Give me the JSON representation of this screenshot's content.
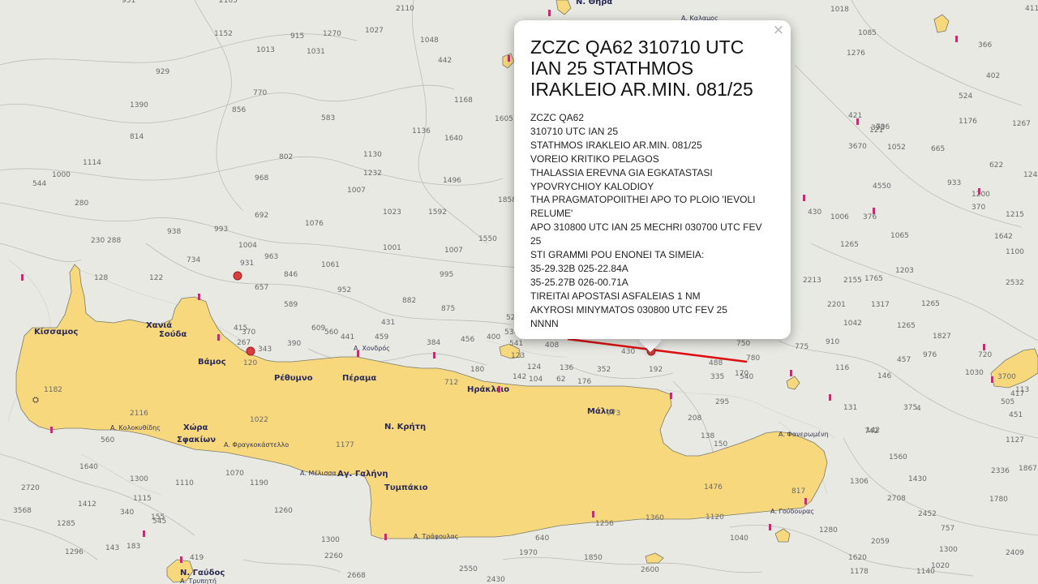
{
  "popup": {
    "close_label": "×",
    "title": "ZCZC QA62 310710 UTC IAN 25 STATHMOS IRAKLEIO AR.MIN. 081/25",
    "lines": [
      "ZCZC QA62",
      "310710 UTC IAN 25",
      "STATHMOS IRAKLEIO AR.MIN. 081/25",
      "VOREIO KRITIKO PELAGOS",
      "THALASSIA EREVNA GIA EGKATASTASI",
      "YPOVRYCHIOY KALODIOY",
      "THA PRAGMATOPOIITHEI APO TO PLOIO 'IEVOLI",
      "RELUME'",
      "APO 310800 UTC IAN 25 MECHRI 030700 UTC FEV",
      "25",
      "STI GRAMMI POU ENONEI TA SIMEIA:",
      "35-29.32B 025-22.84A",
      "35-25.27B 026-00.71A",
      "TIREITAI APOSTASI ASFALEIAS 1 NM",
      "AKYROSI MINYMATOS 030800 UTC FEV 25",
      "NNNN"
    ]
  },
  "places": {
    "thira": "Ν. Θήρα",
    "kalamos": "Α. Καλαμος",
    "kissamos": "Κίσσαμος",
    "chania": "Χανιά",
    "souda": "Σούδα",
    "vamos": "Βάμος",
    "chondros": "Α. Χονδρός",
    "rethymno": "Ρέθυμνο",
    "perama": "Πέραμα",
    "irakleio": "Ηράκλειο",
    "malia": "Μάλια",
    "kriti": "Ν. Κρήτη",
    "kolokythidis": "Α. Κολοκυθίδης",
    "chora": "Χώρα",
    "sfakion": "Σφακίων",
    "frangokastello": "Α. Φραγκοκάστελλο",
    "melissa": "Α. Μέλισσα",
    "ag_galini": "Αγ. Γαλήνη",
    "tympaki": "Τυμπάκιο",
    "trafoulas": "Α. Τράφουλας",
    "goudouras": "Α. Γούδουρας",
    "faneromeni": "Α. Φανερωμένη",
    "gavdos": "Ν. Γαύδος",
    "gavdos_sub": "Α. Τρυπητή"
  },
  "depths": [
    [
      "951",
      150,
      3
    ],
    [
      "2105",
      270,
      3
    ],
    [
      "1152",
      264,
      44
    ],
    [
      "1013",
      316,
      64
    ],
    [
      "915",
      358,
      47
    ],
    [
      "1270",
      398,
      44
    ],
    [
      "1031",
      378,
      66
    ],
    [
      "442",
      540,
      77
    ],
    [
      "1168",
      560,
      126
    ],
    [
      "1027",
      450,
      40
    ],
    [
      "1048",
      518,
      52
    ],
    [
      "2110",
      488,
      13
    ],
    [
      "929",
      192,
      91
    ],
    [
      "1390",
      160,
      132
    ],
    [
      "856",
      286,
      138
    ],
    [
      "770",
      312,
      117
    ],
    [
      "583",
      396,
      148
    ],
    [
      "1136",
      508,
      164
    ],
    [
      "1605",
      610,
      149
    ],
    [
      "814",
      160,
      171
    ],
    [
      "1114",
      102,
      203
    ],
    [
      "802",
      344,
      196
    ],
    [
      "1130",
      448,
      193
    ],
    [
      "1640",
      548,
      173
    ],
    [
      "1000",
      64,
      218
    ],
    [
      "968",
      314,
      222
    ],
    [
      "1232",
      448,
      216
    ],
    [
      "1496",
      546,
      225
    ],
    [
      "1007",
      428,
      237
    ],
    [
      "1858",
      614,
      249
    ],
    [
      "544",
      40,
      229
    ],
    [
      "280",
      92,
      253
    ],
    [
      "692",
      314,
      268
    ],
    [
      "1076",
      376,
      278
    ],
    [
      "1023",
      472,
      264
    ],
    [
      "1592",
      528,
      264
    ],
    [
      "993",
      264,
      285
    ],
    [
      "1550",
      590,
      297
    ],
    [
      "938",
      206,
      288
    ],
    [
      "230 288",
      112,
      299
    ],
    [
      "1004",
      294,
      305
    ],
    [
      "963",
      326,
      319
    ],
    [
      "1061",
      396,
      329
    ],
    [
      "1007",
      548,
      311
    ],
    [
      "1001",
      472,
      308
    ],
    [
      "734",
      230,
      323
    ],
    [
      "931",
      296,
      327
    ],
    [
      "846",
      350,
      341
    ],
    [
      "995",
      542,
      341
    ],
    [
      "128",
      116,
      345
    ],
    [
      "122",
      184,
      345
    ],
    [
      "657",
      314,
      357
    ],
    [
      "952",
      416,
      360
    ],
    [
      "875",
      544,
      383
    ],
    [
      "589",
      350,
      378
    ],
    [
      "882",
      496,
      373
    ],
    [
      "609",
      384,
      407
    ],
    [
      "431",
      470,
      400
    ],
    [
      "528",
      624,
      394
    ],
    [
      "459",
      462,
      418
    ],
    [
      "415",
      288,
      407
    ],
    [
      "456",
      568,
      421
    ],
    [
      "441",
      420,
      418
    ],
    [
      "384",
      526,
      425
    ],
    [
      "400",
      600,
      418
    ],
    [
      "343",
      318,
      433
    ],
    [
      "408",
      672,
      428
    ],
    [
      "430",
      766,
      436
    ],
    [
      "488",
      874,
      450
    ],
    [
      "390",
      354,
      426
    ],
    [
      "352",
      736,
      458
    ],
    [
      "192",
      800,
      458
    ],
    [
      "335",
      876,
      467
    ],
    [
      "540",
      912,
      467
    ],
    [
      "712",
      548,
      474
    ],
    [
      "2116",
      160,
      512
    ],
    [
      "1182",
      54,
      483
    ],
    [
      "973",
      748,
      512
    ],
    [
      "1177",
      414,
      551
    ],
    [
      "1476",
      868,
      603
    ],
    [
      "817",
      976,
      608
    ],
    [
      "1640",
      98,
      578
    ],
    [
      "2720",
      26,
      604
    ],
    [
      "1412",
      96,
      624
    ],
    [
      "3568",
      16,
      632
    ],
    [
      "1190",
      308,
      598
    ],
    [
      "1260",
      338,
      632
    ],
    [
      "1110",
      216,
      598
    ],
    [
      "1070",
      278,
      586
    ],
    [
      "1256",
      734,
      648
    ],
    [
      "1360",
      796,
      641
    ],
    [
      "1120",
      870,
      640
    ],
    [
      "2452",
      1132,
      636
    ],
    [
      "2059",
      1074,
      670
    ],
    [
      "1620",
      1046,
      690
    ],
    [
      "1280",
      1010,
      656
    ],
    [
      "757",
      1160,
      654
    ],
    [
      "2409",
      1240,
      684
    ],
    [
      "1867",
      1256,
      580
    ],
    [
      "2336",
      1222,
      583
    ],
    [
      "1127",
      1240,
      545
    ],
    [
      "1765",
      1066,
      346
    ],
    [
      "1203",
      1104,
      336
    ],
    [
      "2532",
      1240,
      351
    ],
    [
      "2213",
      990,
      348
    ],
    [
      "2155",
      1040,
      348
    ],
    [
      "1827",
      1150,
      417
    ],
    [
      "1642",
      1226,
      294
    ],
    [
      "1065",
      1098,
      293
    ],
    [
      "1265",
      1036,
      304
    ],
    [
      "1248",
      1262,
      218
    ],
    [
      "1267",
      1248,
      155
    ],
    [
      "1176",
      1182,
      152
    ],
    [
      "796",
      1080,
      159
    ],
    [
      "524",
      1182,
      121
    ],
    [
      "366",
      1206,
      58
    ],
    [
      "402",
      1216,
      96
    ],
    [
      "411",
      1264,
      13
    ],
    [
      "1276",
      1044,
      68
    ],
    [
      "1085",
      1058,
      43
    ],
    [
      "1018",
      1024,
      14
    ],
    [
      "665",
      1148,
      186
    ],
    [
      "622",
      1220,
      206
    ],
    [
      "933",
      1168,
      228
    ],
    [
      "1006",
      1024,
      270
    ],
    [
      "376",
      1064,
      270
    ],
    [
      "430",
      996,
      264
    ],
    [
      "121",
      1072,
      163
    ],
    [
      "393",
      1074,
      160
    ],
    [
      "910",
      1018,
      424
    ],
    [
      "775",
      980,
      430
    ],
    [
      "780",
      920,
      444
    ],
    [
      "750",
      908,
      426
    ],
    [
      "457",
      1106,
      446
    ],
    [
      "976",
      1138,
      440
    ],
    [
      "116",
      1030,
      456
    ],
    [
      "146",
      1082,
      466
    ],
    [
      "131",
      1040,
      505
    ],
    [
      "142",
      1068,
      533
    ],
    [
      "742",
      1066,
      534
    ],
    [
      "375",
      1114,
      505
    ],
    [
      "4",
      1130,
      506
    ],
    [
      "451",
      1244,
      514
    ],
    [
      "417",
      1246,
      488
    ],
    [
      "113",
      1252,
      483
    ],
    [
      "505",
      1234,
      498
    ],
    [
      "1030",
      1190,
      462
    ],
    [
      "3700",
      1230,
      467
    ],
    [
      "720",
      1206,
      440
    ],
    [
      "208",
      848,
      518
    ],
    [
      "295",
      882,
      498
    ],
    [
      "150",
      880,
      550
    ],
    [
      "138",
      864,
      540
    ],
    [
      "170",
      906,
      463
    ],
    [
      "176",
      712,
      473
    ],
    [
      "62",
      686,
      470
    ],
    [
      "124",
      650,
      455
    ],
    [
      "142",
      632,
      467
    ],
    [
      "136",
      690,
      456
    ],
    [
      "123",
      630,
      441
    ],
    [
      "104",
      652,
      470
    ],
    [
      "120",
      300,
      450
    ],
    [
      "267",
      292,
      425
    ],
    [
      "370",
      298,
      412
    ],
    [
      "180",
      580,
      458
    ],
    [
      "530",
      622,
      412
    ],
    [
      "541",
      628,
      426
    ],
    [
      "1296",
      80,
      683
    ],
    [
      "143",
      130,
      678
    ],
    [
      "183",
      156,
      676
    ],
    [
      "1300",
      396,
      668
    ],
    [
      "2260",
      400,
      688
    ],
    [
      "2668",
      428,
      712
    ],
    [
      "2430",
      600,
      717
    ],
    [
      "640",
      660,
      666
    ],
    [
      "1970",
      640,
      684
    ],
    [
      "1850",
      720,
      690
    ],
    [
      "2550",
      566,
      704
    ],
    [
      "340",
      148,
      634
    ],
    [
      "560",
      124,
      545
    ],
    [
      "2600",
      790,
      705
    ],
    [
      "1140",
      1130,
      707
    ],
    [
      "1178",
      1048,
      707
    ],
    [
      "2708",
      1094,
      617
    ],
    [
      "1430",
      1120,
      593
    ],
    [
      "1780",
      1220,
      618
    ],
    [
      "1306",
      1048,
      596
    ],
    [
      "1560",
      1096,
      566
    ],
    [
      "1300",
      160,
      593
    ],
    [
      "1115",
      164,
      617
    ],
    [
      "545",
      188,
      645
    ],
    [
      "1285",
      70,
      648
    ],
    [
      "419",
      234,
      690
    ],
    [
      "155",
      186,
      640
    ],
    [
      "1020",
      1148,
      700
    ],
    [
      "1300",
      1158,
      680
    ],
    [
      "1040",
      900,
      666
    ],
    [
      "560",
      400,
      412
    ],
    [
      "1022",
      308,
      520
    ],
    [
      "421",
      1046,
      145
    ],
    [
      "3670",
      1046,
      183
    ],
    [
      "1052",
      1094,
      184
    ],
    [
      "4550",
      1076,
      232
    ],
    [
      "1200",
      1198,
      242
    ],
    [
      "370",
      1198,
      258
    ],
    [
      "1215",
      1240,
      267
    ],
    [
      "1100",
      1240,
      313
    ],
    [
      "1265",
      1136,
      377
    ],
    [
      "1042",
      1040,
      401
    ],
    [
      "2201",
      1020,
      378
    ],
    [
      "1317",
      1074,
      378
    ],
    [
      "1265",
      1106,
      404
    ]
  ],
  "colors": {
    "sea": "#e8e9e3",
    "land": "#f8d87c",
    "route": "#dd1111",
    "marker": "#d73f3f"
  }
}
